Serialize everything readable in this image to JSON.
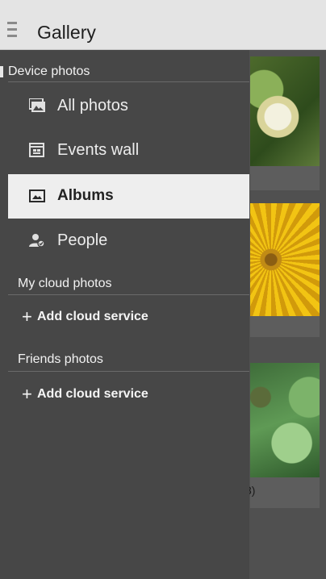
{
  "appbar": {
    "title": "Gallery",
    "menu_icon": "hamburger-menu-icon"
  },
  "drawer": {
    "device_section": "Device photos",
    "device_items": [
      {
        "label": "All photos",
        "icon": "photos-icon"
      },
      {
        "label": "Events wall",
        "icon": "calendar-icon"
      },
      {
        "label": "Albums",
        "icon": "album-icon",
        "selected": true
      },
      {
        "label": "People",
        "icon": "people-icon"
      }
    ],
    "cloud_section": "My cloud photos",
    "cloud_add_label": "Add cloud service",
    "friends_section": "Friends photos",
    "friends_add_label": "Add cloud service"
  },
  "background": {
    "card3_caption_fragment": "3)"
  },
  "colors": {
    "appbar": "#e4e4e4",
    "drawer": "#474747",
    "selected_item": "#eeeeee"
  }
}
